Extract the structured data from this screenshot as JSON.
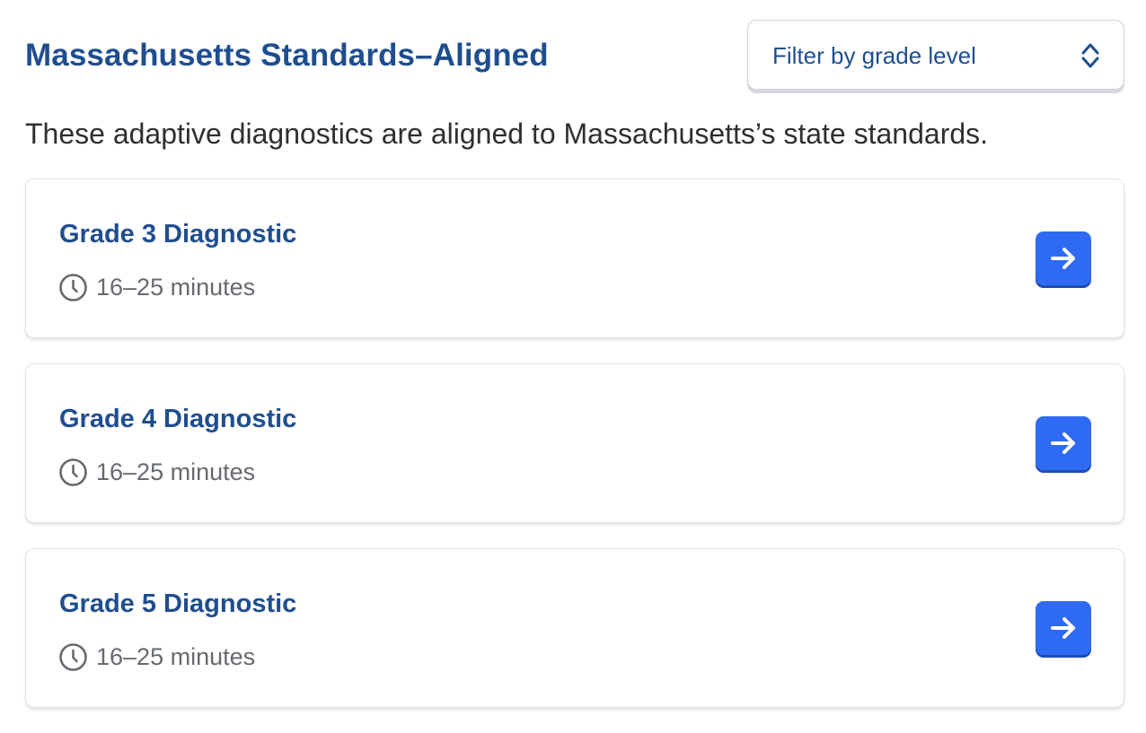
{
  "header": {
    "title": "Massachusetts Standards–Aligned",
    "filter": {
      "label": "Filter by grade level",
      "icon": "chevron-up-down-icon"
    }
  },
  "intro": {
    "text": "These adaptive diagnostics are aligned to Massachusetts’s state standards."
  },
  "diagnostics": [
    {
      "title": "Grade 3 Diagnostic",
      "duration": "16–25 minutes",
      "icon": "clock-icon",
      "action_icon": "arrow-right-icon"
    },
    {
      "title": "Grade 4 Diagnostic",
      "duration": "16–25 minutes",
      "icon": "clock-icon",
      "action_icon": "arrow-right-icon"
    },
    {
      "title": "Grade 5 Diagnostic",
      "duration": "16–25 minutes",
      "icon": "clock-icon",
      "action_icon": "arrow-right-icon"
    }
  ],
  "colors": {
    "title": "#1f4e8f",
    "accent_button": "#2f6bf2",
    "body_text": "#2f2f2f",
    "muted_text": "#666a70"
  }
}
